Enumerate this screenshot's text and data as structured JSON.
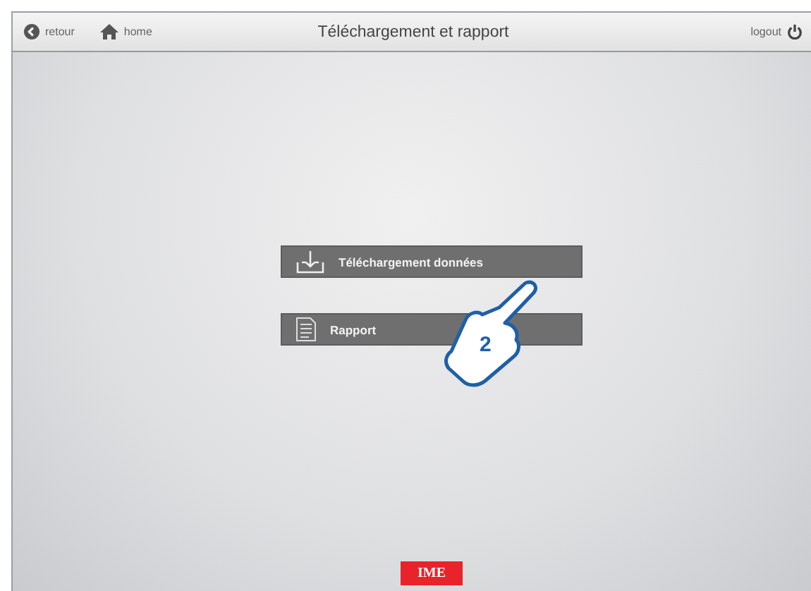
{
  "top_bar": {
    "back": "retour",
    "home": "home",
    "title": "Téléchargement et rapport",
    "logout": "logout"
  },
  "menu": [
    {
      "kind": "download",
      "label": "Téléchargement données"
    },
    {
      "kind": "report",
      "label": "Rapport"
    }
  ],
  "annotation": {
    "step": "2"
  },
  "footer": {
    "logo": "IME"
  }
}
